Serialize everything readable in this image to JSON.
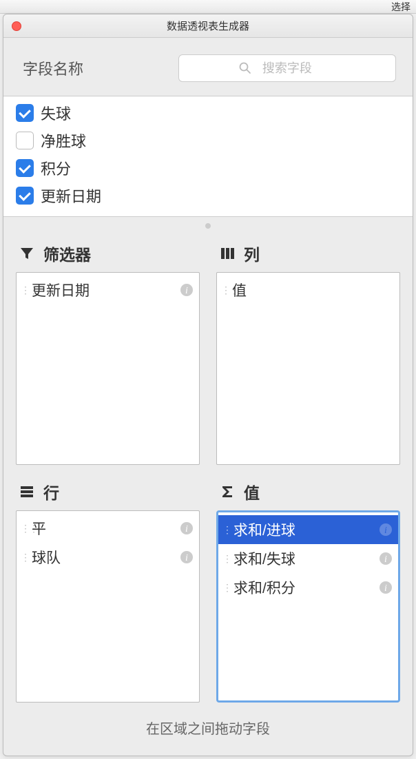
{
  "toolbar": {
    "right_text": "选择"
  },
  "window": {
    "title": "数据透视表生成器"
  },
  "header": {
    "label": "字段名称",
    "search_placeholder": "搜索字段"
  },
  "fields": [
    {
      "label": "失球",
      "checked": true
    },
    {
      "label": "净胜球",
      "checked": false
    },
    {
      "label": "积分",
      "checked": true
    },
    {
      "label": "更新日期",
      "checked": true
    }
  ],
  "zones": {
    "filter": {
      "title": "筛选器",
      "items": [
        {
          "label": "更新日期",
          "info": true
        }
      ]
    },
    "columns": {
      "title": "列",
      "items": [
        {
          "label": "值",
          "info": false
        }
      ]
    },
    "rows": {
      "title": "行",
      "items": [
        {
          "label": "平",
          "info": true
        },
        {
          "label": "球队",
          "info": true
        }
      ]
    },
    "values": {
      "title": "值",
      "selected": true,
      "items": [
        {
          "label": "求和/进球",
          "info": true,
          "highlighted": true
        },
        {
          "label": "求和/失球",
          "info": true
        },
        {
          "label": "求和/积分",
          "info": true
        }
      ]
    }
  },
  "footer": {
    "hint": "在区域之间拖动字段"
  }
}
